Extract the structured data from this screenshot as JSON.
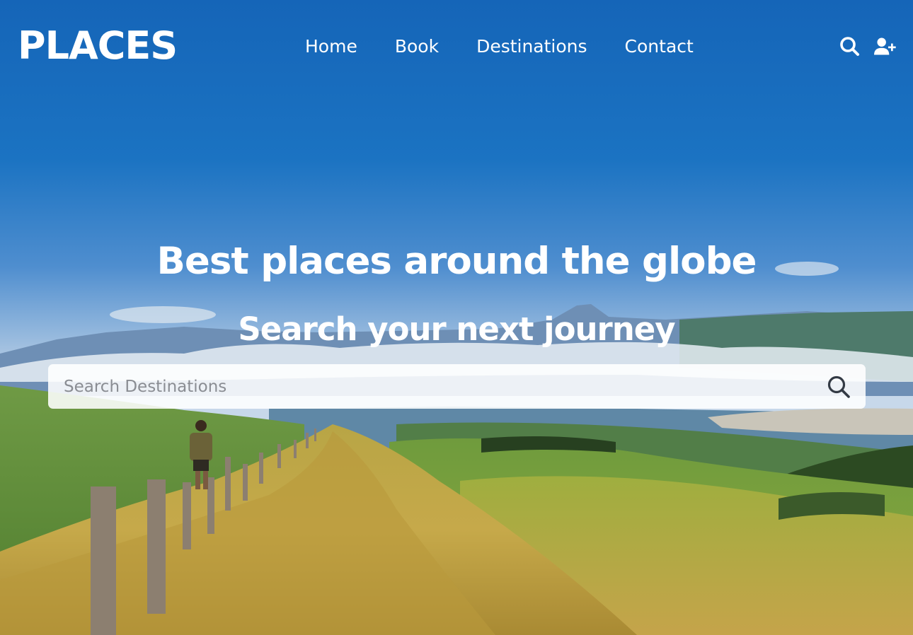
{
  "header": {
    "logo": "PLACES",
    "nav": [
      {
        "label": "Home"
      },
      {
        "label": "Book"
      },
      {
        "label": "Destinations"
      },
      {
        "label": "Contact"
      }
    ],
    "icons": [
      "search-icon",
      "add-user-icon"
    ]
  },
  "hero": {
    "headline": "Best places around the globe",
    "subheadline": "Search your next journey",
    "background": "mountain-landscape-photo"
  },
  "search": {
    "placeholder": "Search Destinations",
    "value": "",
    "icon": "search-icon"
  },
  "colors": {
    "sky_top": "#1565b8",
    "text": "#ffffff",
    "search_bg": "#f2f3f5",
    "placeholder": "#8a8d93"
  }
}
